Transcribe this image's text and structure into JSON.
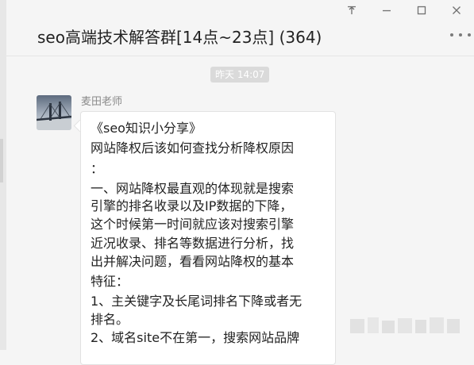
{
  "window": {
    "pin_icon": "pin-icon",
    "minimize_icon": "minimize-icon",
    "maximize_icon": "maximize-icon",
    "close_icon": "close-icon"
  },
  "header": {
    "title": "seo高端技术解答群[14点~23点] (364)",
    "more_icon": "more-dots-icon"
  },
  "chat": {
    "timestamp": "昨天 14:07",
    "message": {
      "sender": "麦田老师",
      "lines": [
        "《seo知识小分享》",
        "网站降权后该如何查找分析降权原因",
        "：",
        "一、网站降权最直观的体现就是搜索",
        "引擎的排名收录以及IP数据的下降，",
        "这个时候第一时间就应该对搜索引擎",
        "近况收录、排名等数据进行分析，找",
        "出并解决问题，看看网站降权的基本",
        "特征：",
        "1、主关键字及长尾词排名下降或者无",
        "排名。",
        "2、域名site不在第一，搜索网站品牌"
      ]
    }
  },
  "colors": {
    "background": "#f5f5f5",
    "bubble": "#ffffff",
    "timestamp_bg": "#dadada"
  }
}
